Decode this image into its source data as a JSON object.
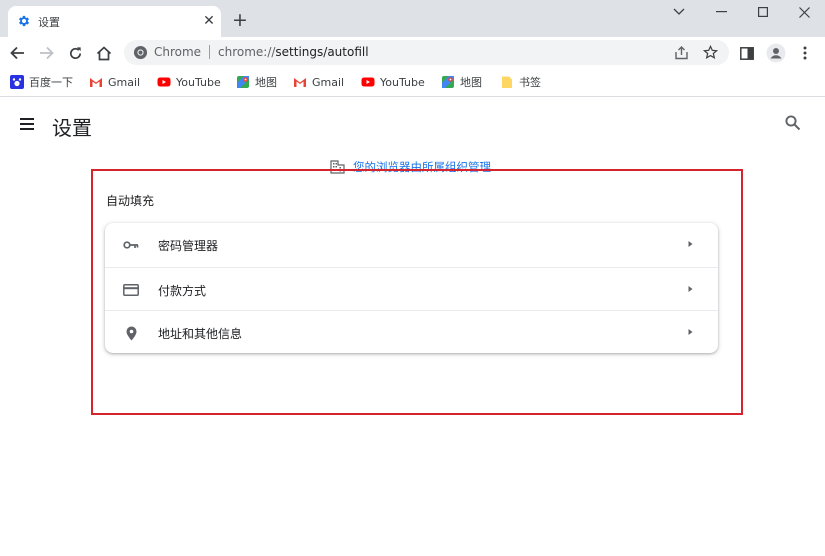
{
  "tab": {
    "title": "设置",
    "close_glyph": "✕",
    "new_tab_glyph": "+"
  },
  "window_controls": [
    "chevron-down",
    "minimize",
    "maximize",
    "close"
  ],
  "omnibox": {
    "scheme_label": "Chrome",
    "url_prefix": "chrome://",
    "url_path": "settings/autofill"
  },
  "bookmarks": [
    {
      "label": "百度一下",
      "icon": "baidu-icon"
    },
    {
      "label": "Gmail",
      "icon": "gmail-icon"
    },
    {
      "label": "YouTube",
      "icon": "youtube-icon"
    },
    {
      "label": "地图",
      "icon": "maps-icon"
    },
    {
      "label": "Gmail",
      "icon": "gmail-icon"
    },
    {
      "label": "YouTube",
      "icon": "youtube-icon"
    },
    {
      "label": "地图",
      "icon": "maps-icon"
    },
    {
      "label": "书签",
      "icon": "folder-icon"
    }
  ],
  "settings": {
    "page_title": "设置",
    "managed_notice": "您的浏览器由所属组织管理",
    "section_title": "自动填充",
    "items": [
      {
        "label": "密码管理器",
        "icon": "key-icon"
      },
      {
        "label": "付款方式",
        "icon": "credit-card-icon"
      },
      {
        "label": "地址和其他信息",
        "icon": "location-pin-icon"
      }
    ]
  },
  "colors": {
    "accent": "#1a73e8",
    "highlight_border": "#d6242e",
    "tabstrip": "#dee1e6"
  }
}
